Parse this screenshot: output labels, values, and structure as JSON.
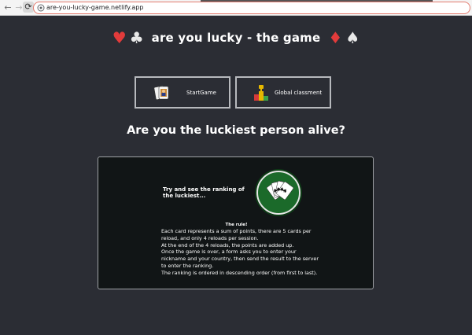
{
  "browser": {
    "url": "are-you-lucky-game.netlify.app"
  },
  "header": {
    "title": "are you lucky - the game",
    "suits_left": [
      "♥",
      "♣"
    ],
    "suits_right": [
      "♦",
      "♠"
    ]
  },
  "buttons": {
    "start_label": "StartGame",
    "ranking_label": "Global classment"
  },
  "headline": "Are you the luckiest person alive?",
  "panel": {
    "tagline": "Try and see the ranking of the luckiest...",
    "rule_title": "The rule!",
    "rules": [
      "Each card represents a sum of points, there are 5 cards per reload, and only 4 reloads per session.",
      "At the end of the 4 reloads, the points are added up.",
      "Once the game is over, a form asks you to enter your nickname and your country, then send the result to the server to enter the ranking.",
      "The ranking is ordered in descending order (from first to last)."
    ]
  },
  "colors": {
    "background": "#2b2d34",
    "panel": "#111516",
    "badge_green": "#1b6a2a",
    "suit_red": "#e23b3b"
  },
  "icons": [
    "back-icon",
    "forward-icon",
    "reload-icon",
    "lock-icon",
    "playing-card-icon",
    "podium-icon",
    "cards-fan-icon"
  ]
}
